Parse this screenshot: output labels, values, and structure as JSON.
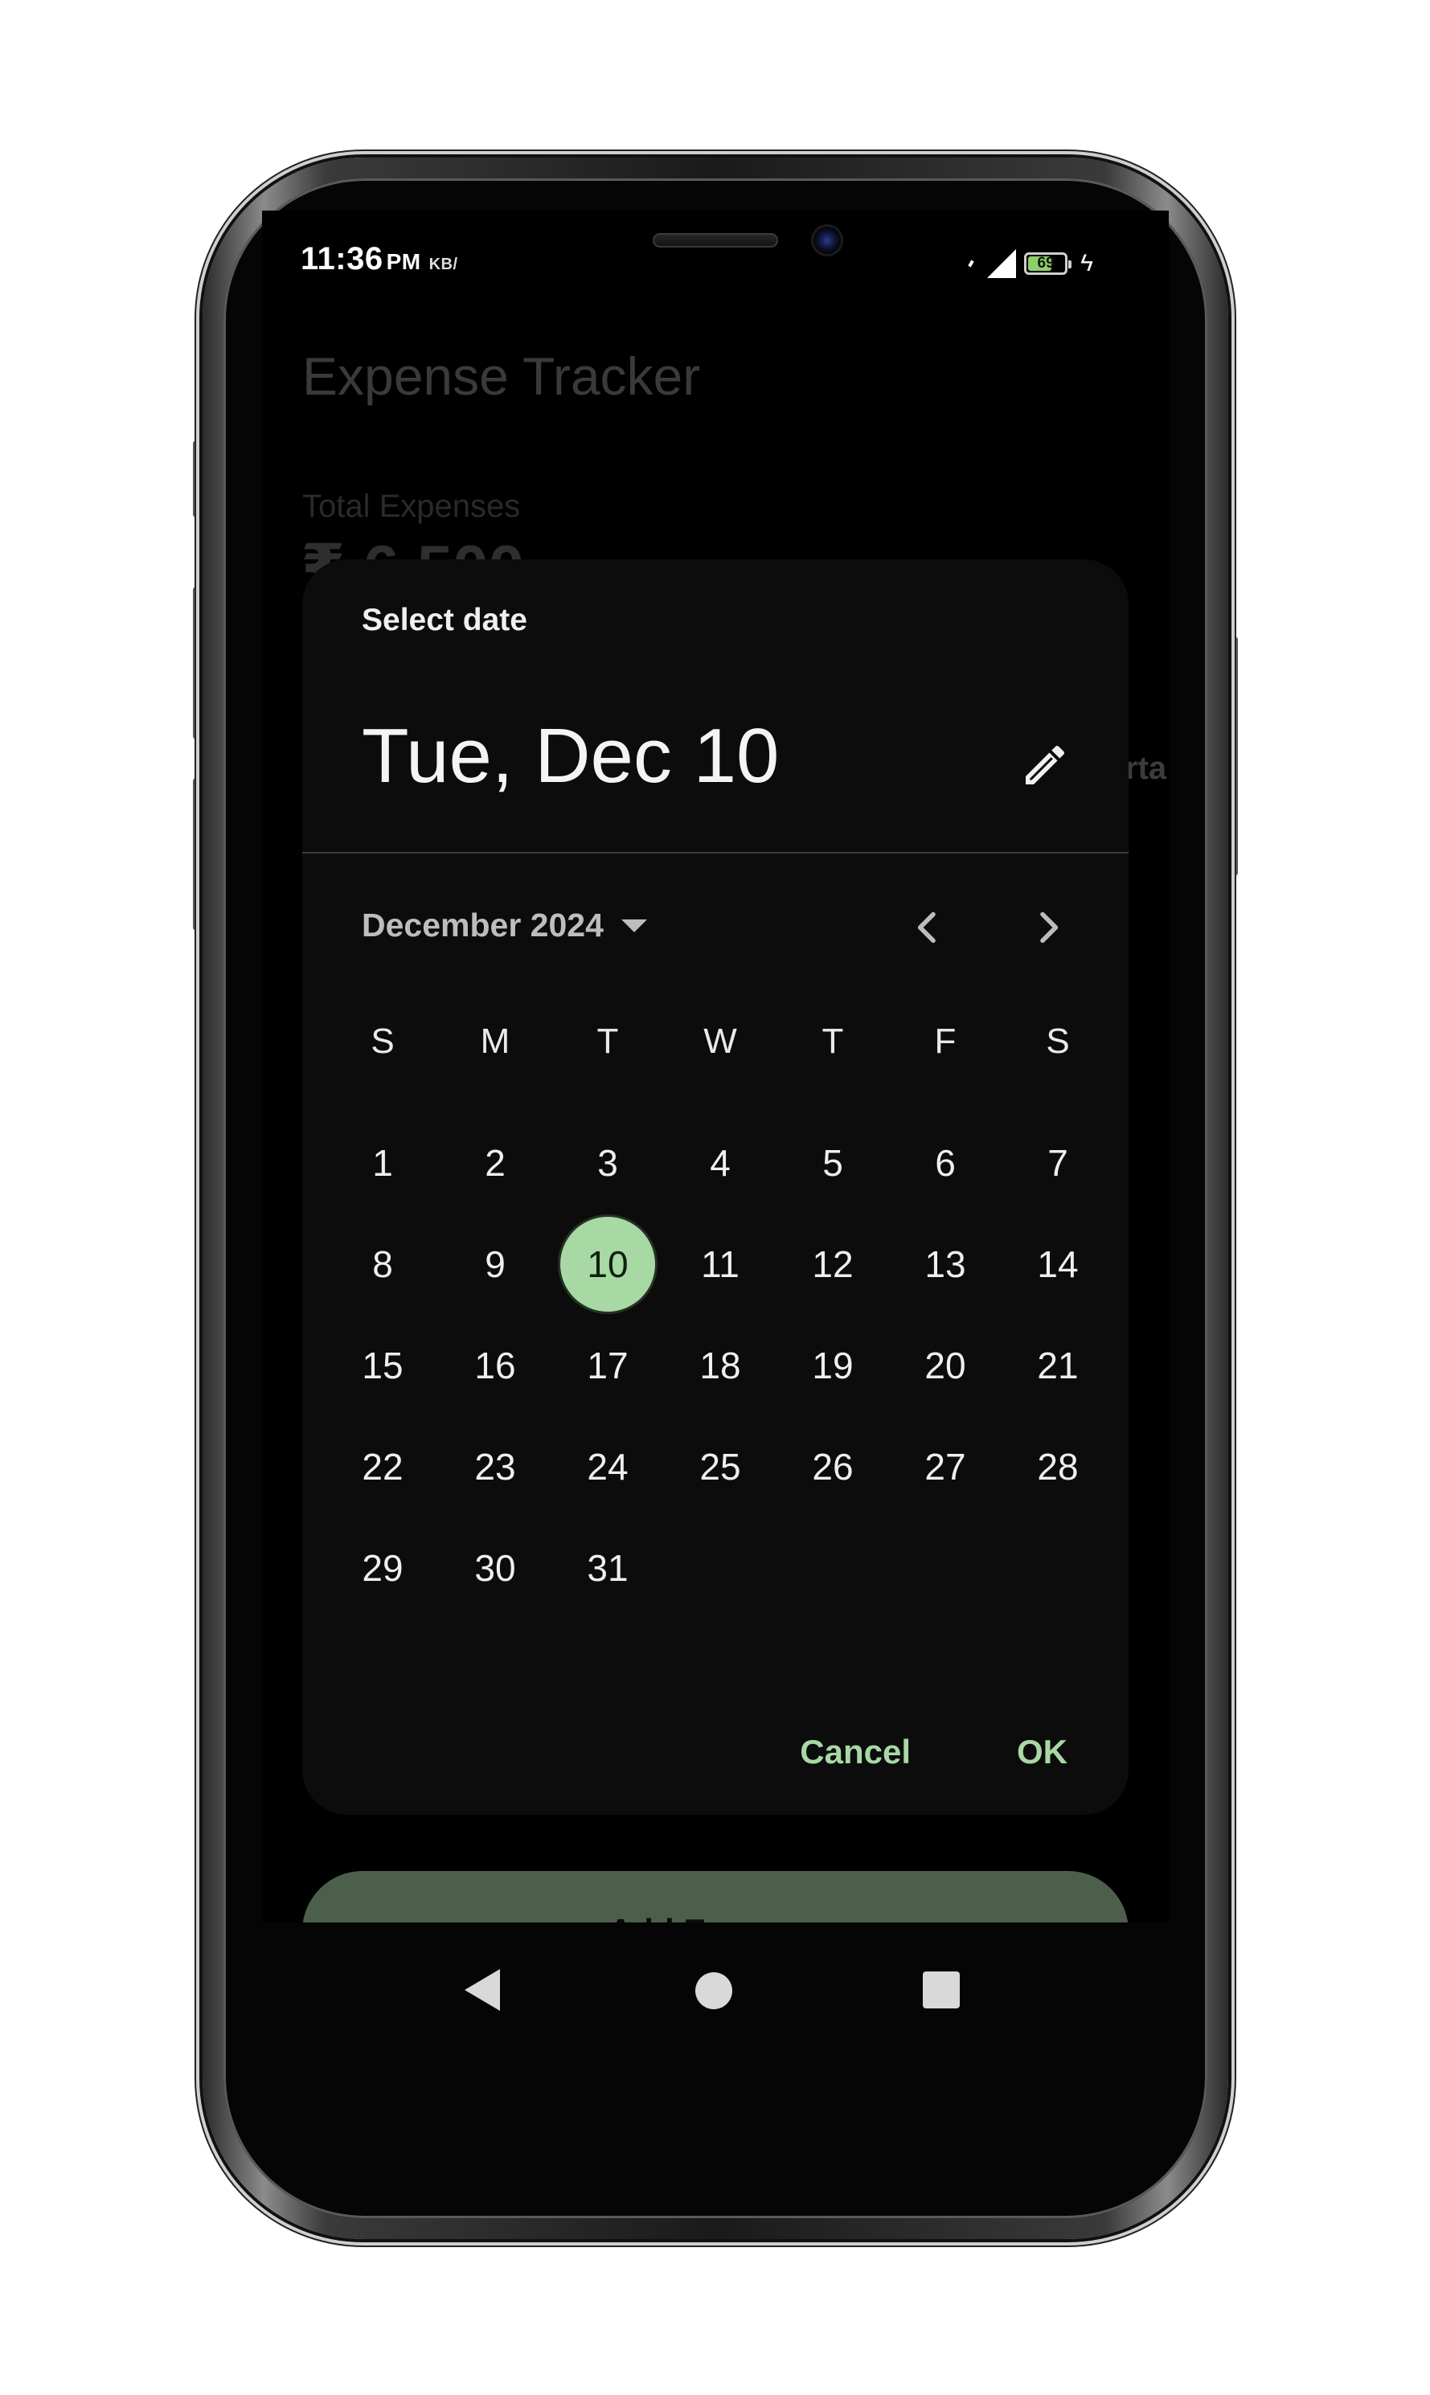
{
  "status_bar": {
    "time": "11:36",
    "ampm": "PM",
    "speed": "KB/",
    "battery_level": "69",
    "battery_fraction": 0.69
  },
  "app": {
    "title": "Expense Tracker",
    "total_label": "Total Expenses",
    "total_value": "₹ 6,500",
    "peek_text": "rta"
  },
  "date_picker": {
    "label": "Select date",
    "headline": "Tue, Dec 10",
    "month_label": "December 2024",
    "weekdays": [
      "S",
      "M",
      "T",
      "W",
      "T",
      "F",
      "S"
    ],
    "first_weekday_index": 0,
    "days": [
      "1",
      "2",
      "3",
      "4",
      "5",
      "6",
      "7",
      "8",
      "9",
      "10",
      "11",
      "12",
      "13",
      "14",
      "15",
      "16",
      "17",
      "18",
      "19",
      "20",
      "21",
      "22",
      "23",
      "24",
      "25",
      "26",
      "27",
      "28",
      "29",
      "30",
      "31"
    ],
    "selected_day": "10",
    "accent_color": "#a8d8a4",
    "cancel_label": "Cancel",
    "ok_label": "OK"
  },
  "add_expense_label": "Add Expense",
  "icons": {
    "edit": "pencil-icon",
    "prev": "chevron-left-icon",
    "next": "chevron-right-icon",
    "dropdown": "caret-down-icon"
  }
}
